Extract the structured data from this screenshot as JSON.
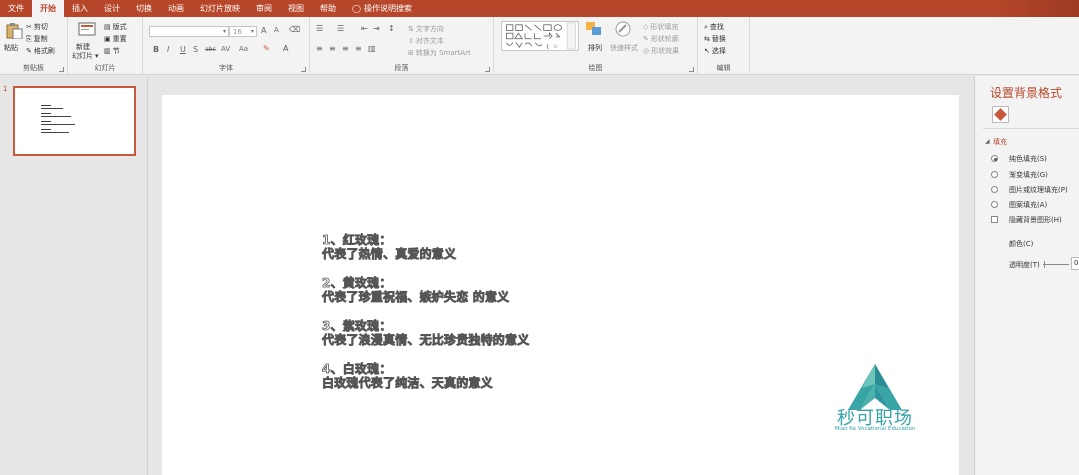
{
  "tabs": [
    "文件",
    "开始",
    "插入",
    "设计",
    "切换",
    "动画",
    "幻灯片放映",
    "审阅",
    "视图",
    "帮助",
    "操作说明搜索"
  ],
  "ribbon": {
    "clipboard": {
      "paste": "粘贴",
      "cut": "剪切",
      "copy": "复制",
      "format_painter": "格式刷",
      "label": "剪贴板"
    },
    "slides": {
      "new_slide": "新建",
      "new_slide2": "幻灯片",
      "layout": "版式",
      "reset": "重置",
      "section": "节",
      "label": "幻灯片"
    },
    "font": {
      "size": "16",
      "label": "字体",
      "bold": "B",
      "italic": "I",
      "underline": "U",
      "shadow": "S",
      "strike": "abc",
      "spacing": "AV",
      "case": "Aa",
      "grow": "A",
      "shrink": "A"
    },
    "paragraph": {
      "text_direction": "文字方向",
      "align_text": "对齐文本",
      "smartart": "转换为 SmartArt",
      "label": "段落"
    },
    "drawing": {
      "arrange": "排列",
      "quick_styles": "快速样式",
      "shape_fill": "形状填充",
      "shape_outline": "形状轮廓",
      "shape_effects": "形状效果",
      "label": "绘图"
    },
    "editing": {
      "find": "查找",
      "replace": "替换",
      "select": "选择",
      "label": "编辑"
    }
  },
  "thumbnail": {
    "number": "1"
  },
  "slide": {
    "lines": [
      "1、红玫瑰：",
      "代表了热情、真爱的意义",
      "",
      "2、黄玫瑰：",
      "代表了珍重祝福、嫉妒失恋 的意义",
      "",
      "3、紫玫瑰：",
      "代表了浪漫真情、无比珍贵独特的意义",
      "",
      "4、白玫瑰：",
      "白玫瑰代表了纯洁、天真的意义"
    ],
    "logo_name": "秒可职场",
    "logo_sub": "Miao Ke Vocational Education"
  },
  "format_pane": {
    "title": "设置背景格式",
    "section": "填充",
    "options": [
      "纯色填充(S)",
      "渐变填充(G)",
      "图片或纹理填充(P)",
      "图案填充(A)"
    ],
    "selected_option": 0,
    "hide_bg": "隐藏背景图形(H)",
    "color_label": "颜色(C)",
    "transparency_label": "透明度(T)",
    "transparency_value": "0"
  },
  "colors": {
    "accent": "#b7472a",
    "logo": "#35a2a8"
  }
}
